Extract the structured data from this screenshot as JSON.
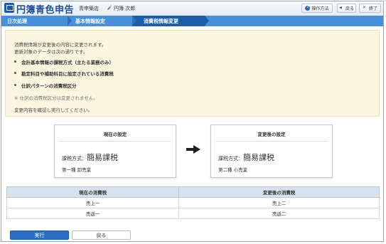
{
  "header": {
    "app_title": "円簿青色申告",
    "company": "青申築店",
    "user": "円簿 次郎",
    "help_label": "操作方法",
    "back_label": "戻る",
    "close_label": "終了"
  },
  "breadcrumb": {
    "items": [
      "日次処理",
      "基本情報設定",
      "消費税情報変更"
    ]
  },
  "notice": {
    "line1": "消費税情報が変更後の内容に変更されます。",
    "line2": "更新対象のデータは次の通りです。",
    "bullets": [
      "会計基本情報の課税方式（主たる業務のみ）",
      "勘定科目や補助科目に設定されている消費税",
      "仕訳パターンの消費税区分"
    ],
    "note": "※ 仕訳の消費税区分は変更されません。",
    "confirm": "変更内容を確認し実行してください。"
  },
  "current_setting": {
    "title": "現在の設定",
    "method_label": "課税方式：",
    "method_value": "簡易課税",
    "category": "第一種 卸売業"
  },
  "new_setting": {
    "title": "変更後の設定",
    "method_label": "課税方式：",
    "method_value": "簡易課税",
    "category": "第二種 小売業"
  },
  "tax_table": {
    "headers": [
      "現在の消費税",
      "変更後の消費税"
    ],
    "rows": [
      [
        "売上一",
        "売上二"
      ],
      [
        "売返一",
        "売返二"
      ]
    ]
  },
  "footer": {
    "execute_label": "実行",
    "back_label": "戻る"
  },
  "colors": {
    "accent": "#2a6fc4",
    "breadcrumb": "#4a90d9",
    "notice_bg": "#fcf6e1"
  }
}
